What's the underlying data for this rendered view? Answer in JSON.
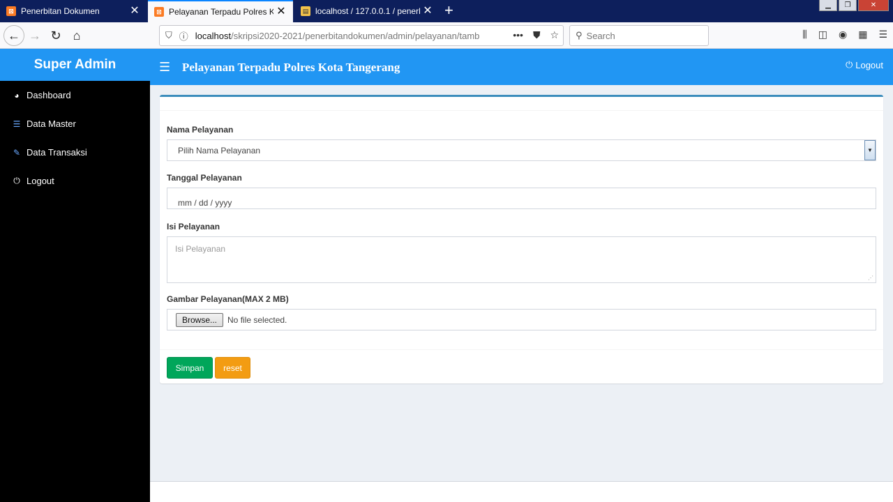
{
  "browser": {
    "tabs": [
      {
        "title": "Penerbitan Dokumen",
        "favicon": "xampp-icon"
      },
      {
        "title": "Pelayanan Terpadu Polres Kota",
        "favicon": "xampp-icon"
      },
      {
        "title": "localhost / 127.0.0.1 / penerbita",
        "favicon": "phpmyadmin-icon"
      }
    ],
    "active_tab": 1,
    "url_host": "localhost",
    "url_path": "/skripsi2020-2021/penerbitandokumen/admin/pelayanan/tamb",
    "search_placeholder": "Search"
  },
  "sidebar": {
    "brand": "Super Admin",
    "items": [
      {
        "label": "Dashboard",
        "icon": "dashboard-icon"
      },
      {
        "label": "Data Master",
        "icon": "list-icon"
      },
      {
        "label": "Data Transaksi",
        "icon": "edit-icon"
      },
      {
        "label": "Logout",
        "icon": "power-icon"
      }
    ]
  },
  "header": {
    "title": "Pelayanan Terpadu Polres Kota Tangerang",
    "logout_label": "Logout"
  },
  "form": {
    "nama_label": "Nama Pelayanan",
    "nama_value": "Pilih Nama Pelayanan",
    "tanggal_label": "Tanggal Pelayanan",
    "tanggal_value": "mm / dd / yyyy",
    "isi_label": "Isi Pelayanan",
    "isi_placeholder": "Isi Pelayanan",
    "gambar_label": "Gambar Pelayanan(MAX 2 MB)",
    "browse_label": "Browse...",
    "file_status": "No file selected.",
    "save_label": "Simpan",
    "reset_label": "reset"
  },
  "colors": {
    "primary": "#2196f3",
    "sidebar_bg": "#000000",
    "success": "#00a65a",
    "warning": "#f39c12"
  }
}
